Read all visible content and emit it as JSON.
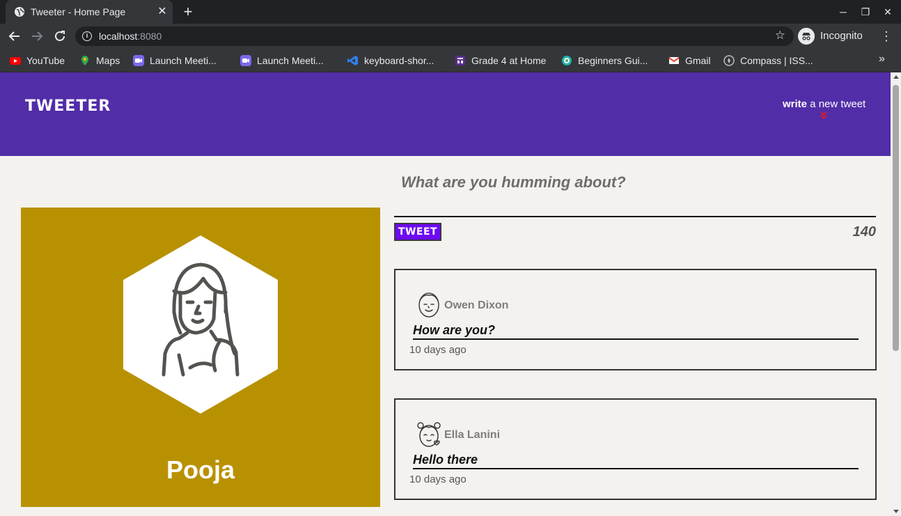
{
  "browser": {
    "tab_title": "Tweeter - Home Page",
    "url_host": "localhost",
    "url_port": ":8080",
    "profile_label": "Incognito",
    "icons": {
      "tab_favicon": "globe-icon",
      "close": "close-icon",
      "new_tab": "plus-icon",
      "back": "arrow-left-icon",
      "forward": "arrow-right-icon",
      "reload": "reload-icon",
      "site_info": "info-icon",
      "bookmark": "star-icon",
      "incognito": "incognito-icon",
      "menu": "kebab-menu-icon"
    }
  },
  "bookmarks": [
    {
      "label": "YouTube",
      "icon": "youtube-icon",
      "color": "#ff0000"
    },
    {
      "label": "Maps",
      "icon": "maps-icon",
      "color": "#34a853"
    },
    {
      "label": "Launch Meeti...",
      "icon": "video-icon",
      "color": "#7b68ee"
    },
    {
      "label": "Launch Meeti...",
      "icon": "video-icon",
      "color": "#7b68ee"
    },
    {
      "label": "keyboard-shor...",
      "icon": "vscode-icon",
      "color": "#2f80ed"
    },
    {
      "label": "Grade 4 at Home",
      "icon": "grade-icon",
      "color": "#5b2d90"
    },
    {
      "label": "Beginners Gui...",
      "icon": "gear-icon",
      "color": "#20b2aa"
    },
    {
      "label": "Gmail",
      "icon": "gmail-icon",
      "color": "#ea4335"
    },
    {
      "label": "Compass | ISS...",
      "icon": "compass-icon",
      "color": "#bdbdbd"
    }
  ],
  "site": {
    "brand": "TWEETER",
    "compose_link_bold": "write",
    "compose_link_rest": " a new tweet",
    "accent_color": "#522da8",
    "chevron_color": "#e01b24"
  },
  "profile": {
    "name": "Pooja",
    "background_color": "#b89100",
    "avatar_icon": "girl-avatar-icon"
  },
  "compose": {
    "prompt": "What are you humming about?",
    "value": "",
    "button_label": "TWEET",
    "counter": "140"
  },
  "tweets": [
    {
      "author": "Owen Dixon",
      "body": "How are you?",
      "time": "10 days ago",
      "avatar_icon": "boy-avatar-icon"
    },
    {
      "author": "Ella Lanini",
      "body": "Hello there",
      "time": "10 days ago",
      "avatar_icon": "girl-pigtails-avatar-icon"
    }
  ]
}
